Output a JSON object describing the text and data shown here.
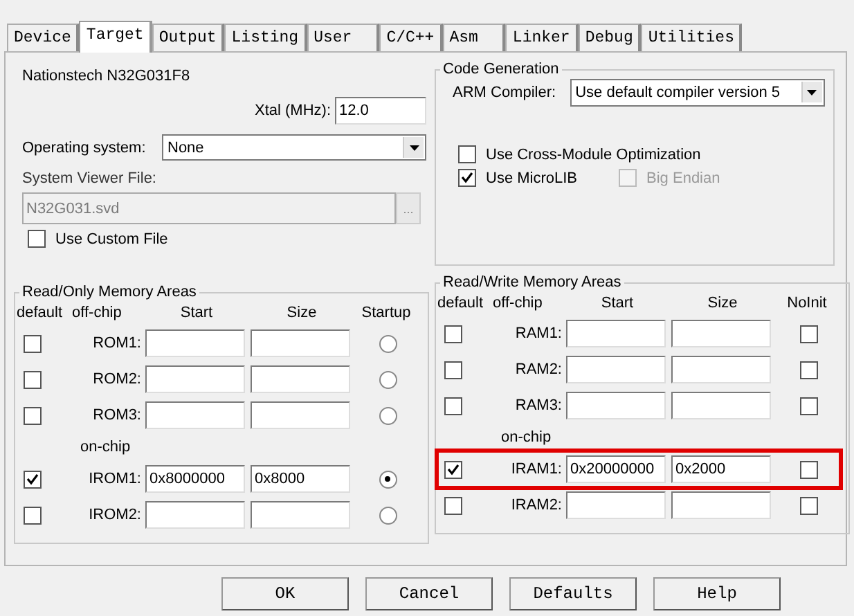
{
  "tabs": [
    {
      "label": "Device",
      "selected": false
    },
    {
      "label": "Target",
      "selected": true
    },
    {
      "label": "Output",
      "selected": false
    },
    {
      "label": "Listing",
      "selected": false
    },
    {
      "label": "User",
      "selected": false
    },
    {
      "label": "C/C++",
      "selected": false
    },
    {
      "label": "Asm",
      "selected": false
    },
    {
      "label": "Linker",
      "selected": false
    },
    {
      "label": "Debug",
      "selected": false
    },
    {
      "label": "Utilities",
      "selected": false
    }
  ],
  "device": {
    "name": "Nationstech N32G031F8",
    "xtal_label": "Xtal (MHz):",
    "xtal_value": "12.0",
    "os_label": "Operating system:",
    "os_value": "None",
    "svf_label": "System Viewer File:",
    "svf_value": "N32G031.svd",
    "browse": "...",
    "custom_file": {
      "label": "Use Custom File",
      "checked": false
    }
  },
  "code_generation": {
    "title": "Code Generation",
    "compiler_label": "ARM Compiler:",
    "compiler_value": "Use default compiler version 5",
    "options": [
      {
        "label": "Use Cross-Module Optimization",
        "checked": false,
        "disabled": false
      },
      {
        "label": "Use MicroLIB",
        "checked": true,
        "disabled": false
      },
      {
        "label": "Big Endian",
        "checked": false,
        "disabled": true
      }
    ]
  },
  "rom_areas": {
    "title": "Read/Only Memory Areas",
    "columns": [
      "default",
      "off-chip",
      "Start",
      "Size",
      "Startup"
    ],
    "rows": [
      {
        "kind": "area",
        "default": false,
        "label": "ROM1:",
        "start": "",
        "size": "",
        "startup": false,
        "highlighted": false
      },
      {
        "kind": "area",
        "default": false,
        "label": "ROM2:",
        "start": "",
        "size": "",
        "startup": false,
        "highlighted": false
      },
      {
        "kind": "area",
        "default": false,
        "label": "ROM3:",
        "start": "",
        "size": "",
        "startup": false,
        "highlighted": false
      },
      {
        "kind": "label",
        "label": "on-chip"
      },
      {
        "kind": "area",
        "default": true,
        "label": "IROM1:",
        "start": "0x8000000",
        "size": "0x8000",
        "startup": true,
        "highlighted": false
      },
      {
        "kind": "area",
        "default": false,
        "label": "IROM2:",
        "start": "",
        "size": "",
        "startup": false,
        "highlighted": false
      }
    ]
  },
  "ram_areas": {
    "title": "Read/Write Memory Areas",
    "columns": [
      "default",
      "off-chip",
      "Start",
      "Size",
      "NoInit"
    ],
    "rows": [
      {
        "kind": "area",
        "default": false,
        "label": "RAM1:",
        "start": "",
        "size": "",
        "noinit": false,
        "highlighted": false
      },
      {
        "kind": "area",
        "default": false,
        "label": "RAM2:",
        "start": "",
        "size": "",
        "noinit": false,
        "highlighted": false
      },
      {
        "kind": "area",
        "default": false,
        "label": "RAM3:",
        "start": "",
        "size": "",
        "noinit": false,
        "highlighted": false
      },
      {
        "kind": "label",
        "label": "on-chip"
      },
      {
        "kind": "area",
        "default": true,
        "label": "IRAM1:",
        "start": "0x20000000",
        "size": "0x2000",
        "noinit": false,
        "highlighted": true
      },
      {
        "kind": "area",
        "default": false,
        "label": "IRAM2:",
        "start": "",
        "size": "",
        "noinit": false,
        "highlighted": false
      }
    ]
  },
  "buttons": [
    "OK",
    "Cancel",
    "Defaults",
    "Help"
  ]
}
